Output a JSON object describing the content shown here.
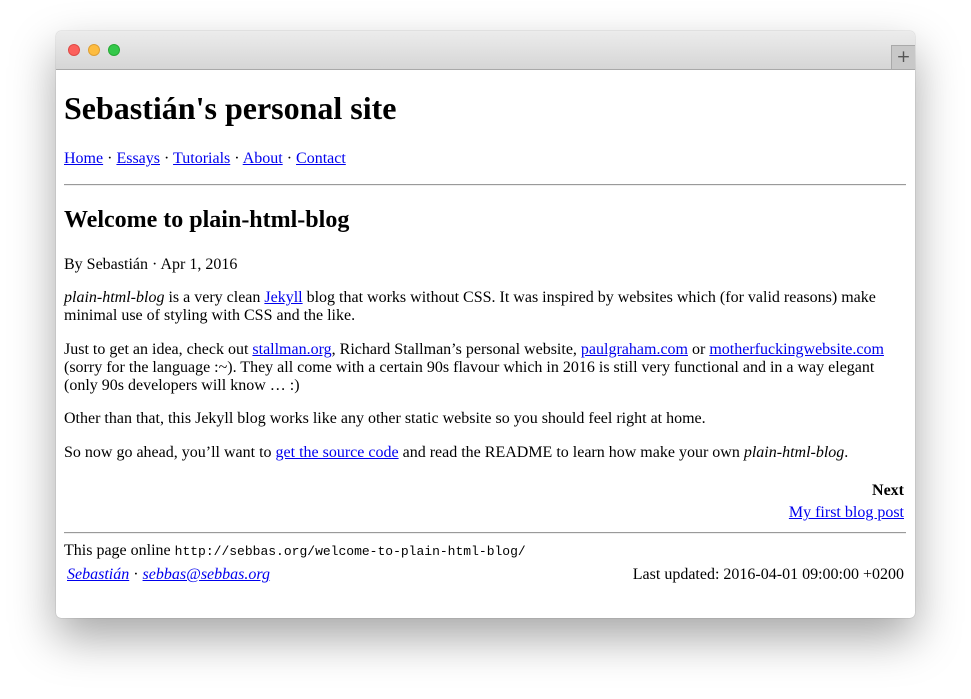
{
  "window": {
    "controls": [
      "close",
      "minimize",
      "zoom"
    ],
    "new_tab_label": "+"
  },
  "site": {
    "title": "Sebastián's personal site",
    "nav": [
      {
        "label": "Home"
      },
      {
        "label": "Essays"
      },
      {
        "label": "Tutorials"
      },
      {
        "label": "About"
      },
      {
        "label": "Contact"
      }
    ],
    "separator": "·"
  },
  "post": {
    "title": "Welcome to plain-html-blog",
    "byline": "By Sebastián · Apr 1, 2016",
    "p1": {
      "em": "plain-html-blog",
      "t1": " is a very clean ",
      "link": "Jekyll",
      "t2": " blog that works without CSS. It was inspired by websites which (for valid reasons) make minimal use of styling with CSS and the like."
    },
    "p2": {
      "t1": "Just to get an idea, check out ",
      "link1": "stallman.org",
      "t2": ", Richard Stallman’s personal website, ",
      "link2": "paulgraham.com",
      "t3": " or ",
      "link3": "motherfuckingwebsite.com",
      "t4": " (sorry for the language :~). They all come with a certain 90s flavour which in 2016 is still very functional and in a way elegant (only 90s developers will know … :)"
    },
    "p3": "Other than that, this Jekyll blog works like any other static website so you should feel right at home.",
    "p4": {
      "t1": "So now go ahead, you’ll want to ",
      "link": "get the source code",
      "t2": " and read the README to learn how make your own ",
      "em": "plain-html-blog",
      "t3": "."
    },
    "next_label": "Next",
    "next_link": "My first blog post"
  },
  "footer": {
    "online_label": "This page online ",
    "online_url": "http://sebbas.org/welcome-to-plain-html-blog/",
    "author_link": "Sebastián",
    "separator": " · ",
    "email_link": "sebbas@sebbas.org",
    "last_updated": "Last updated: 2016-04-01 09:00:00 +0200"
  }
}
